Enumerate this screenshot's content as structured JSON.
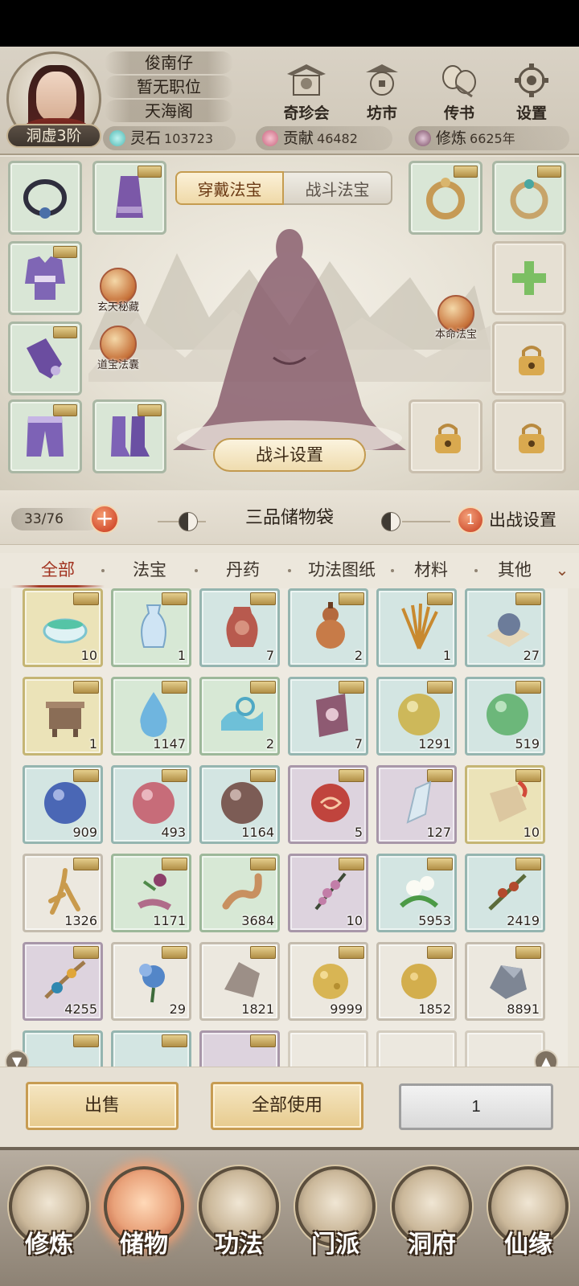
{
  "player": {
    "name": "俊南仔",
    "position": "暂无职位",
    "sect": "天海阁",
    "realm": "洞虚3阶"
  },
  "top_menu": [
    {
      "label": "奇珍会",
      "icon": "treasure-pavilion-icon"
    },
    {
      "label": "坊市",
      "icon": "market-icon"
    },
    {
      "label": "传书",
      "icon": "letter-icon"
    },
    {
      "label": "设置",
      "icon": "gear-icon"
    }
  ],
  "currencies": {
    "spirit_stone": {
      "label": "灵石",
      "value": "103723"
    },
    "contribution": {
      "label": "贡献",
      "value": "46482"
    },
    "cultivation": {
      "label": "修炼",
      "value": "6625年"
    }
  },
  "equip": {
    "tab_wear": "穿戴法宝",
    "tab_battle": "战斗法宝",
    "badge_xuantian": "玄天秘藏",
    "badge_daobao": "道宝法囊",
    "badge_benming": "本命法宝",
    "battle_setting": "战斗设置"
  },
  "bag": {
    "capacity": "33/76",
    "title": "三品储物袋",
    "battle_count": "1",
    "battle_setup": "出战设置"
  },
  "categories": [
    "全部",
    "法宝",
    "丹药",
    "功法图纸",
    "材料",
    "其他"
  ],
  "items": [
    {
      "name": "jade-bowl",
      "count": "10",
      "quality": "yellow"
    },
    {
      "name": "blue-vase",
      "count": "1",
      "quality": "green"
    },
    {
      "name": "red-jar",
      "count": "7",
      "quality": "blue"
    },
    {
      "name": "gourd",
      "count": "2",
      "quality": "blue"
    },
    {
      "name": "herb-grass",
      "count": "1",
      "quality": "blue"
    },
    {
      "name": "pearl-on-cloth",
      "count": "27",
      "quality": "blue"
    },
    {
      "name": "bronze-cauldron",
      "count": "1",
      "quality": "yellow"
    },
    {
      "name": "water-drop",
      "count": "1147",
      "quality": "green"
    },
    {
      "name": "water-wave",
      "count": "2",
      "quality": "green"
    },
    {
      "name": "talisman-seal",
      "count": "7",
      "quality": "blue"
    },
    {
      "name": "yellow-orb",
      "count": "1291",
      "quality": "blue"
    },
    {
      "name": "green-orb",
      "count": "519",
      "quality": "blue"
    },
    {
      "name": "blue-orb",
      "count": "909",
      "quality": "blue"
    },
    {
      "name": "pink-orb",
      "count": "493",
      "quality": "blue"
    },
    {
      "name": "brown-orb",
      "count": "1164",
      "quality": "blue"
    },
    {
      "name": "red-spiral-orb",
      "count": "5",
      "quality": "purple"
    },
    {
      "name": "crystal-shard",
      "count": "127",
      "quality": "purple"
    },
    {
      "name": "flame-token",
      "count": "10",
      "quality": "yellow"
    },
    {
      "name": "ginseng-root",
      "count": "1326",
      "quality": "white"
    },
    {
      "name": "purple-flower-root",
      "count": "1171",
      "quality": "green"
    },
    {
      "name": "twisted-root",
      "count": "3684",
      "quality": "green"
    },
    {
      "name": "berry-branch",
      "count": "10",
      "quality": "purple"
    },
    {
      "name": "white-flower",
      "count": "5953",
      "quality": "blue"
    },
    {
      "name": "red-berry-twig",
      "count": "2419",
      "quality": "blue"
    },
    {
      "name": "blue-fruit-branch",
      "count": "4255",
      "quality": "purple"
    },
    {
      "name": "blue-lotus",
      "count": "29",
      "quality": "white"
    },
    {
      "name": "grey-stone",
      "count": "1821",
      "quality": "white"
    },
    {
      "name": "gold-ore",
      "count": "9999",
      "quality": "white"
    },
    {
      "name": "gold-nugget",
      "count": "1852",
      "quality": "white"
    },
    {
      "name": "iron-ore",
      "count": "8891",
      "quality": "white"
    }
  ],
  "actions": {
    "sell": "出售",
    "use_all": "全部使用",
    "quantity": "1"
  },
  "bottom_nav": [
    {
      "label": "修炼",
      "active": false
    },
    {
      "label": "储物",
      "active": true
    },
    {
      "label": "功法",
      "active": false
    },
    {
      "label": "门派",
      "active": false
    },
    {
      "label": "洞府",
      "active": false
    },
    {
      "label": "仙缘",
      "active": false
    }
  ]
}
